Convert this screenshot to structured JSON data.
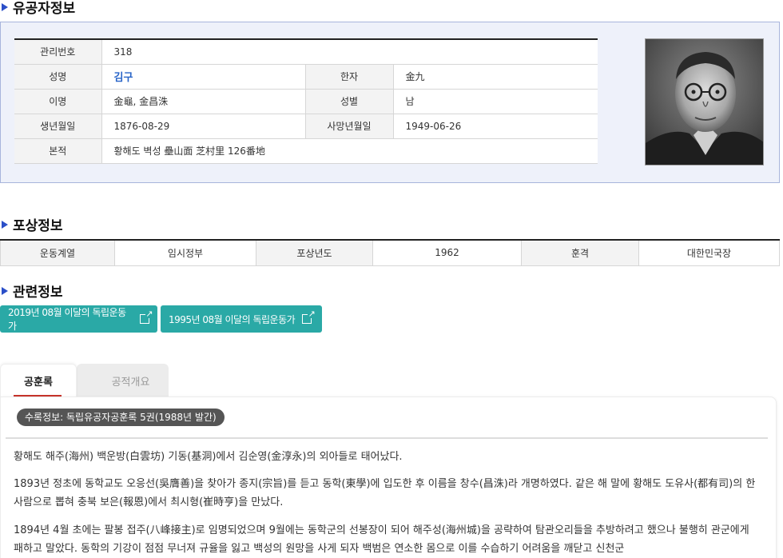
{
  "profile": {
    "section_title": "유공자정보",
    "rows": {
      "mgmt_label": "관리번호",
      "mgmt_value": "318",
      "name_label": "성명",
      "name_value": "김구",
      "hanja_label": "한자",
      "hanja_value": "金九",
      "alias_label": "이명",
      "alias_value": "金龜, 金昌洙",
      "gender_label": "성별",
      "gender_value": "남",
      "birth_label": "생년월일",
      "birth_value": "1876-08-29",
      "death_label": "사망년월일",
      "death_value": "1949-06-26",
      "origin_label": "본적",
      "origin_value": "황해도 벽성 壘山面 芝村里 126番地"
    }
  },
  "award": {
    "section_title": "포상정보",
    "movement_label": "운동계열",
    "movement_value": "임시정부",
    "year_label": "포상년도",
    "year_value": "1962",
    "medal_label": "훈격",
    "medal_value": "대한민국장"
  },
  "related": {
    "section_title": "관련정보",
    "buttons": [
      "2019년 08월 이달의 독립운동가",
      "1995년 08월 이달의 독립운동가"
    ]
  },
  "tabs": [
    {
      "label": "공훈록",
      "active": true
    },
    {
      "label": "공적개요",
      "active": false
    }
  ],
  "content": {
    "source_badge": "수록정보: 독립유공자공훈록 5권(1988년 발간)",
    "paragraphs": [
      "황해도 해주(海州) 백운방(白雲坊) 기동(基洞)에서 김순영(金淳永)의 외아들로 태어났다.",
      "1893년 정초에 동학교도 오응선(吳膺善)을 찾아가 종지(宗旨)를 듣고 동학(東學)에 입도한 후 이름을 창수(昌洙)라 개명하였다. 같은 해 말에 황해도 도유사(都有司)의 한 사람으로 뽑혀 충북 보은(報恩)에서 최시형(崔時亨)을 만났다.",
      "1894년 4월 초에는 팔봉 접주(八峰接主)로 임명되었으며 9월에는 동학군의 선봉장이 되어 해주성(海州城)을 공략하여 탐관오리들을 추방하려고 했으나 불행히 관군에게 패하고 말았다. 동학의 기강이 점점 무너져 규율을 잃고 백성의 원망을 사게 되자 백범은 연소한 몸으로 이를 수습하기 어려움을 깨닫고 신천군"
    ]
  },
  "colors": {
    "accent_blue": "#2b4fc8",
    "teal": "#2aa9a6",
    "tab_red": "#c8332b"
  }
}
